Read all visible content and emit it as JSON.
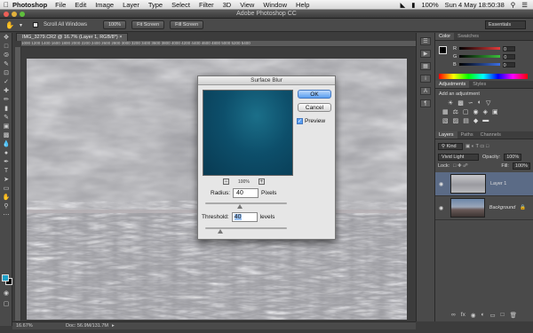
{
  "menubar": {
    "app_name": "Photoshop",
    "items": [
      "File",
      "Edit",
      "Image",
      "Layer",
      "Type",
      "Select",
      "Filter",
      "3D",
      "View",
      "Window",
      "Help"
    ],
    "battery": "100%",
    "clock": "Sun 4 May  18:50:38"
  },
  "window": {
    "title": "Adobe Photoshop CC"
  },
  "options_bar": {
    "scroll_all_windows": "Scroll All Windows",
    "btn_100": "100%",
    "btn_fit": "Fit Screen",
    "btn_fill": "Fill Screen",
    "workspace": "Essentials"
  },
  "document": {
    "tab": "IMG_3279.CR2 @ 16.7% (Layer 1, RGB/8*) ×",
    "ruler": "1000  1200  1400  1600  1800  2000  2200  2400  2600  2800  3000  3200  3400  3600  3800  4000  4200  4400  4600  4800  5000  5200  5400",
    "zoom": "16.67%",
    "doc_size": "Doc: 56.9M/131.7M"
  },
  "dialog": {
    "title": "Surface Blur",
    "ok": "OK",
    "cancel": "Cancel",
    "preview_label": "Preview",
    "preview_checked": true,
    "preview_zoom": "100%",
    "radius_label": "Radius:",
    "radius_value": "40",
    "radius_unit": "Pixels",
    "radius_slider_fraction": 0.42,
    "threshold_label": "Threshold:",
    "threshold_value": "40",
    "threshold_unit": "levels",
    "threshold_slider_fraction": 0.18
  },
  "color_panel": {
    "tabs": [
      "Color",
      "Swatches"
    ],
    "channels": [
      {
        "label": "R",
        "value": "0",
        "color": "#e43c3c"
      },
      {
        "label": "G",
        "value": "0",
        "color": "#3cbf3c"
      },
      {
        "label": "B",
        "value": "0",
        "color": "#3c6fe4"
      }
    ]
  },
  "adjustments_panel": {
    "tabs": [
      "Adjustments",
      "Styles"
    ],
    "hint": "Add an adjustment"
  },
  "layers_panel": {
    "tabs": [
      "Layers",
      "Paths",
      "Channels"
    ],
    "kind": "Kind",
    "blend_mode": "Vivid Light",
    "opacity_label": "Opacity:",
    "opacity_value": "100%",
    "lock_label": "Lock:",
    "fill_label": "Fill:",
    "fill_value": "100%",
    "layers": [
      {
        "name": "Layer 1",
        "selected": true
      },
      {
        "name": "Background",
        "selected": false
      }
    ]
  },
  "colors": {
    "foreground": "#1ea0c8",
    "background": "#000000",
    "accent": "#5a9ef0"
  }
}
